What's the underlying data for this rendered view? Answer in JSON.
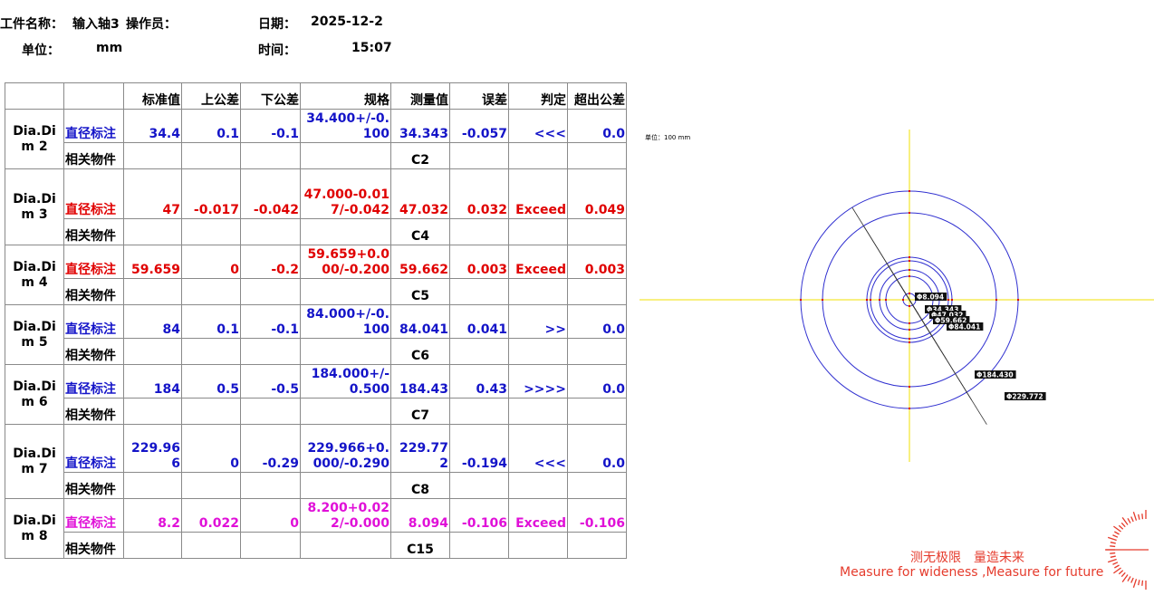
{
  "header": {
    "part_label": "工件名称：",
    "part_value": "输入轴3",
    "operator_label": "操作员：",
    "date_label": "日期：",
    "date_value": "2025-12-2",
    "unit_label": "单位：",
    "unit_value": "mm",
    "time_label": "时间：",
    "time_value": "15:07"
  },
  "table": {
    "columns": [
      "",
      "",
      "标准值",
      "上公差",
      "下公差",
      "规格",
      "测量值",
      "误差",
      "判定",
      "超出公差"
    ],
    "related_label": "相关物件",
    "rows": [
      {
        "label": "Dia.Dim 2",
        "kind": "直径标注",
        "color": "#1414c8",
        "nominal": "34.4",
        "upper": "0.1",
        "lower": "-0.1",
        "spec": "34.400+/-0.100",
        "measured": "34.343",
        "error": "-0.057",
        "verdict": "<<<",
        "exceed": "0.0",
        "related": "C2"
      },
      {
        "label": "Dia.Dim 3",
        "kind": "直径标注",
        "color": "#e00000",
        "nominal": "47",
        "upper": "-0.017",
        "lower": "-0.042",
        "spec": "47.000-0.017/-0.042",
        "measured": "47.032",
        "error": "0.032",
        "verdict": "Exceed",
        "exceed": "0.049",
        "related": "C4"
      },
      {
        "label": "Dia.Dim 4",
        "kind": "直径标注",
        "color": "#e00000",
        "nominal": "59.659",
        "upper": "0",
        "lower": "-0.2",
        "spec": "59.659+0.000/-0.200",
        "measured": "59.662",
        "error": "0.003",
        "verdict": "Exceed",
        "exceed": "0.003",
        "related": "C5"
      },
      {
        "label": "Dia.Dim 5",
        "kind": "直径标注",
        "color": "#1414c8",
        "nominal": "84",
        "upper": "0.1",
        "lower": "-0.1",
        "spec": "84.000+/-0.100",
        "measured": "84.041",
        "error": "0.041",
        "verdict": ">>",
        "exceed": "0.0",
        "related": "C6"
      },
      {
        "label": "Dia.Dim 6",
        "kind": "直径标注",
        "color": "#1414c8",
        "nominal": "184",
        "upper": "0.5",
        "lower": "-0.5",
        "spec": "184.000+/-0.500",
        "measured": "184.43",
        "error": "0.43",
        "verdict": ">>>>",
        "exceed": "0.0",
        "related": "C7"
      },
      {
        "label": "Dia.Dim 7",
        "kind": "直径标注",
        "color": "#1414c8",
        "nominal": "229.966",
        "upper": "0",
        "lower": "-0.29",
        "spec": "229.966+0.000/-0.290",
        "measured": "229.772",
        "error": "-0.194",
        "verdict": "<<<",
        "exceed": "0.0",
        "related": "C8"
      },
      {
        "label": "Dia.Dim 8",
        "kind": "直径标注",
        "color": "#e010d8",
        "nominal": "8.2",
        "upper": "0.022",
        "lower": "0",
        "spec": "8.200+0.022/-0.000",
        "measured": "8.094",
        "error": "-0.106",
        "verdict": "Exceed",
        "exceed": "-0.106",
        "related": "C15"
      }
    ]
  },
  "drawing": {
    "unit_note": "单位：100 mm",
    "circle_color": "#3030d0",
    "axis_color": "#f0e000",
    "labels": [
      "Φ8.094",
      "Φ34.343",
      "Φ47.032",
      "Φ59.662",
      "Φ84.041",
      "Φ184.430",
      "Φ229.772"
    ]
  },
  "slogan": {
    "cn": "测无极限　量造未来",
    "en": "Measure for wideness ,Measure for future"
  }
}
